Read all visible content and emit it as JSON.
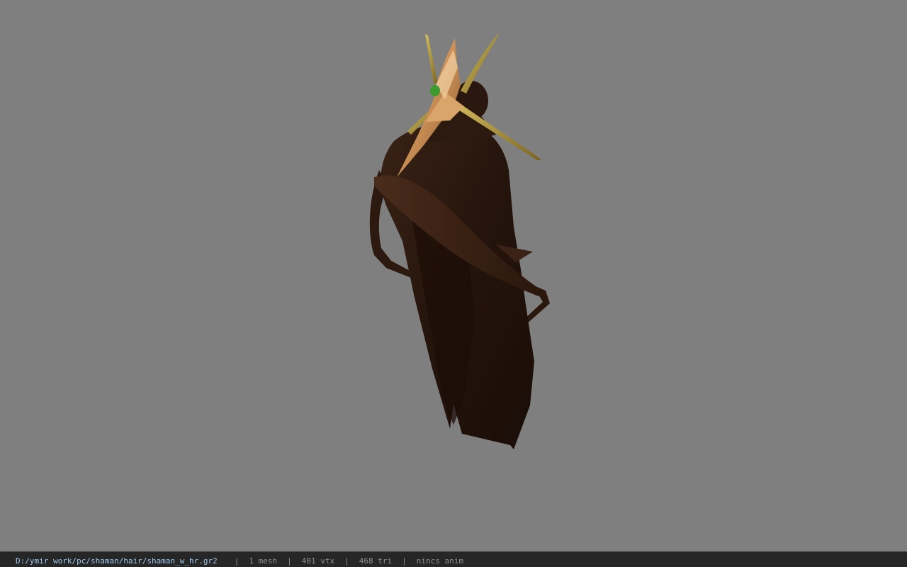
{
  "status_bar": {
    "file_path": "D:/ymir work/pc/shaman/hair/shaman_w_hr.gr2",
    "separator": "|",
    "mesh_count": "1 mesh",
    "vertex_count": "401 vtx",
    "triangle_count": "468 tri",
    "animation": "nincs anim"
  },
  "viewport": {
    "background_color": "#7f7f7f",
    "model": "hair-mesh"
  },
  "colors": {
    "hair_dark": "#2a1810",
    "hair_mid": "#4a2c1c",
    "ornament_gold": "#d9a56a",
    "ornament_pin": "#b49a3c",
    "gem_green": "#3d9a2c",
    "path_text": "#9ec8ee",
    "status_text": "#8f8f8f"
  }
}
